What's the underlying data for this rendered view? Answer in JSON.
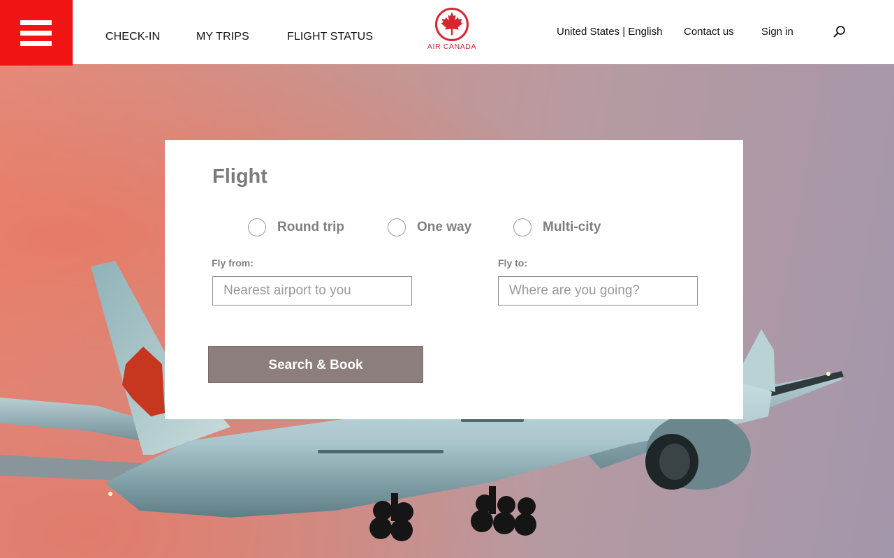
{
  "header": {
    "menu_icon": "hamburger-menu-icon",
    "nav": {
      "checkin": "CHECK-IN",
      "my_trips": "MY TRIPS",
      "flight_status": "FLIGHT STATUS"
    },
    "logo_text": "AIR CANADA",
    "region": "United States | English",
    "contact": "Contact us",
    "sign_in": "Sign in",
    "search_icon": "search-icon"
  },
  "booking": {
    "title": "Flight",
    "trip_types": [
      "Round trip",
      "One way",
      "Multi-city"
    ],
    "from_label": "Fly from:",
    "from_placeholder": "Nearest airport to you",
    "to_label": "Fly to:",
    "to_placeholder": "Where are you going?",
    "submit_label": "Search & Book"
  },
  "colors": {
    "brand_red": "#f01414",
    "logo_red": "#d8262e",
    "button_gray": "#8b7e7d",
    "label_gray": "#7f7f7f"
  }
}
